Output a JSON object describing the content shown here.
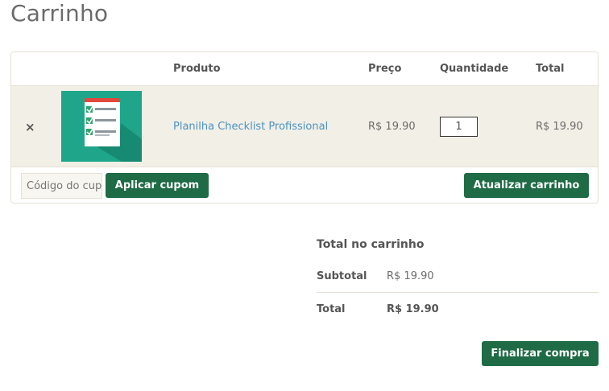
{
  "page": {
    "title": "Carrinho"
  },
  "table": {
    "headers": {
      "product": "Produto",
      "price": "Preço",
      "quantity": "Quantidade",
      "total": "Total"
    },
    "items": [
      {
        "remove_symbol": "×",
        "product_name": "Planilha Checklist Profissional",
        "price": "R$ 19.90",
        "quantity": "1",
        "total": "R$ 19.90"
      }
    ]
  },
  "actions": {
    "coupon_placeholder": "Código do cupom",
    "apply_coupon_label": "Aplicar cupom",
    "update_cart_label": "Atualizar carrinho"
  },
  "totals": {
    "title": "Total no carrinho",
    "subtotal_label": "Subtotal",
    "subtotal_value": "R$ 19.90",
    "total_label": "Total",
    "total_value": "R$ 19.90"
  },
  "checkout": {
    "label": "Finalizar compra"
  },
  "colors": {
    "accent": "#1e6b45",
    "link": "#4b92c4",
    "row_bg": "#f2efe6",
    "thumb_bg": "#1fa68a"
  }
}
